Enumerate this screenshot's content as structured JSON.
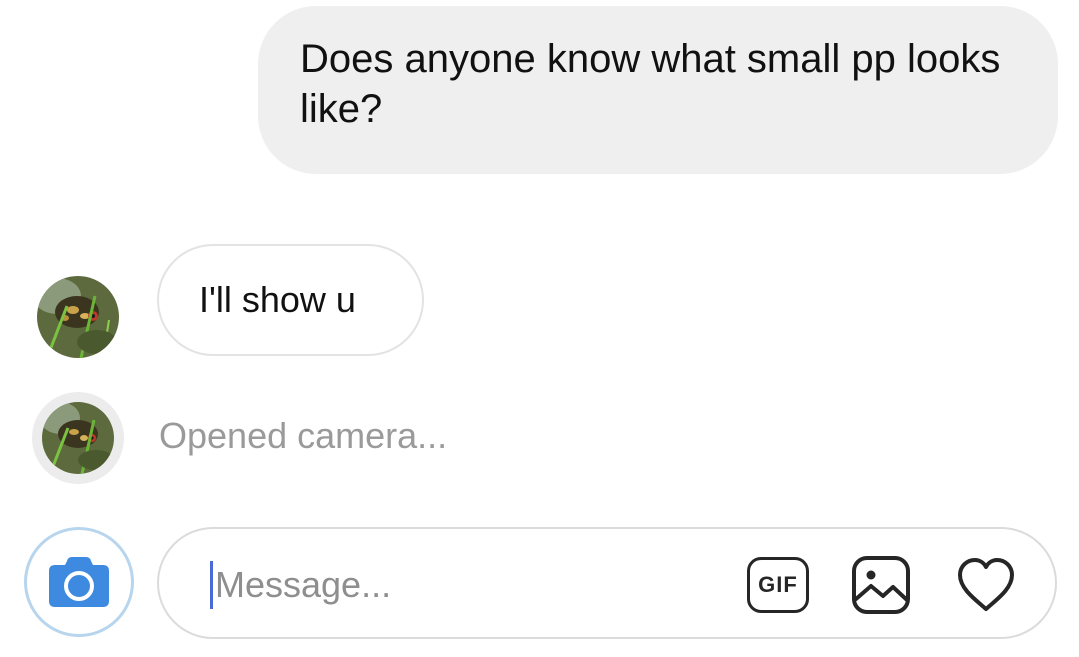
{
  "conversation": {
    "messages": [
      {
        "direction": "outgoing",
        "text": "Does anyone know what small pp looks like?"
      },
      {
        "direction": "incoming",
        "text": "I'll show u"
      }
    ],
    "status": "Opened camera..."
  },
  "composer": {
    "placeholder": "Message...",
    "gif_label": "GIF",
    "icons": [
      "camera-icon",
      "gif-icon",
      "gallery-icon",
      "heart-icon"
    ]
  },
  "colors": {
    "outgoing_bubble": "#efefef",
    "incoming_border": "#e3e3e3",
    "camera_button": "#3897f0",
    "status_text": "#9a9a9a",
    "caret": "#4a6ad6"
  }
}
